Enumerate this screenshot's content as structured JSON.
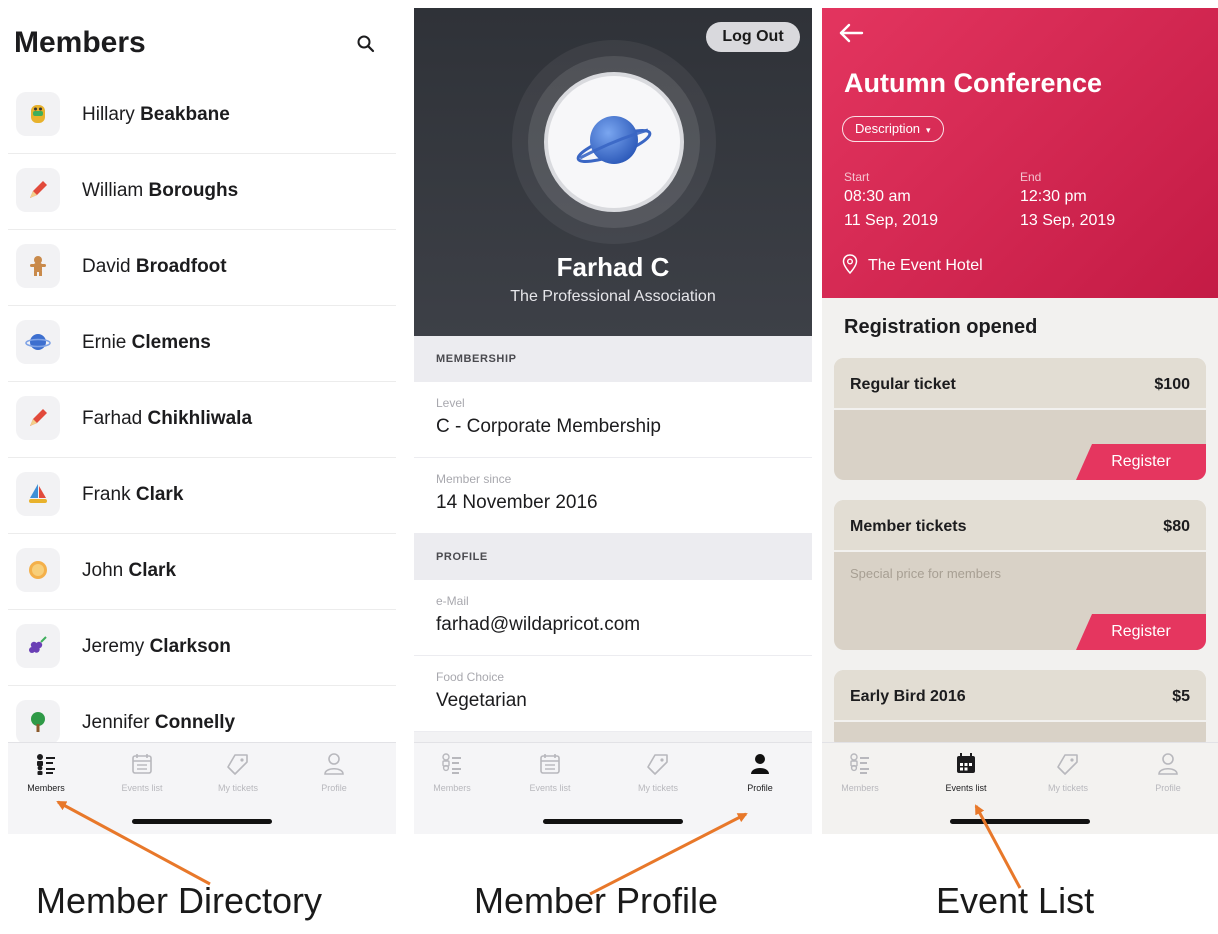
{
  "directory": {
    "title": "Members",
    "members": [
      {
        "first": "Hillary",
        "last": "Beakbane",
        "icon": "robot-icon"
      },
      {
        "first": "William",
        "last": "Boroughs",
        "icon": "pencil-icon"
      },
      {
        "first": "David",
        "last": "Broadfoot",
        "icon": "gingerbread-icon"
      },
      {
        "first": "Ernie",
        "last": "Clemens",
        "icon": "planet-icon"
      },
      {
        "first": "Farhad",
        "last": "Chikhliwala",
        "icon": "pencil-icon"
      },
      {
        "first": "Frank",
        "last": "Clark",
        "icon": "sailboat-icon"
      },
      {
        "first": "John",
        "last": "Clark",
        "icon": "orange-icon"
      },
      {
        "first": "Jeremy",
        "last": "Clarkson",
        "icon": "grapes-icon"
      },
      {
        "first": "Jennifer",
        "last": "Connelly",
        "icon": "tree-icon"
      }
    ]
  },
  "profile": {
    "logout_label": "Log Out",
    "name": "Farhad C",
    "organization": "The Professional Association",
    "membership_header": "MEMBERSHIP",
    "level_label": "Level",
    "level_value": "C - Corporate Membership",
    "since_label": "Member since",
    "since_value": "14 November 2016",
    "profile_header": "PROFILE",
    "email_label": "e-Mail",
    "email_value": "farhad@wildapricot.com",
    "food_label": "Food Choice",
    "food_value": "Vegetarian"
  },
  "event": {
    "title": "Autumn Conference",
    "description_label": "Description",
    "start_label": "Start",
    "start_time": "08:30 am",
    "start_date": "11 Sep, 2019",
    "end_label": "End",
    "end_time": "12:30 pm",
    "end_date": "13 Sep, 2019",
    "venue": "The Event Hotel",
    "registration_heading": "Registration opened",
    "tickets": [
      {
        "name": "Regular ticket",
        "price": "$100",
        "description": "",
        "register_label": "Register"
      },
      {
        "name": "Member tickets",
        "price": "$80",
        "description": "Special price for members",
        "register_label": "Register"
      },
      {
        "name": "Early Bird 2016",
        "price": "$5"
      }
    ]
  },
  "tabs": {
    "members": "Members",
    "events": "Events list",
    "tickets": "My tickets",
    "profile": "Profile"
  },
  "captions": {
    "directory": "Member Directory",
    "profile": "Member Profile",
    "events": "Event List"
  },
  "colors": {
    "accent": "#e5365f",
    "profile_bg": "#34373d",
    "annotation_arrow": "#e8782a"
  }
}
